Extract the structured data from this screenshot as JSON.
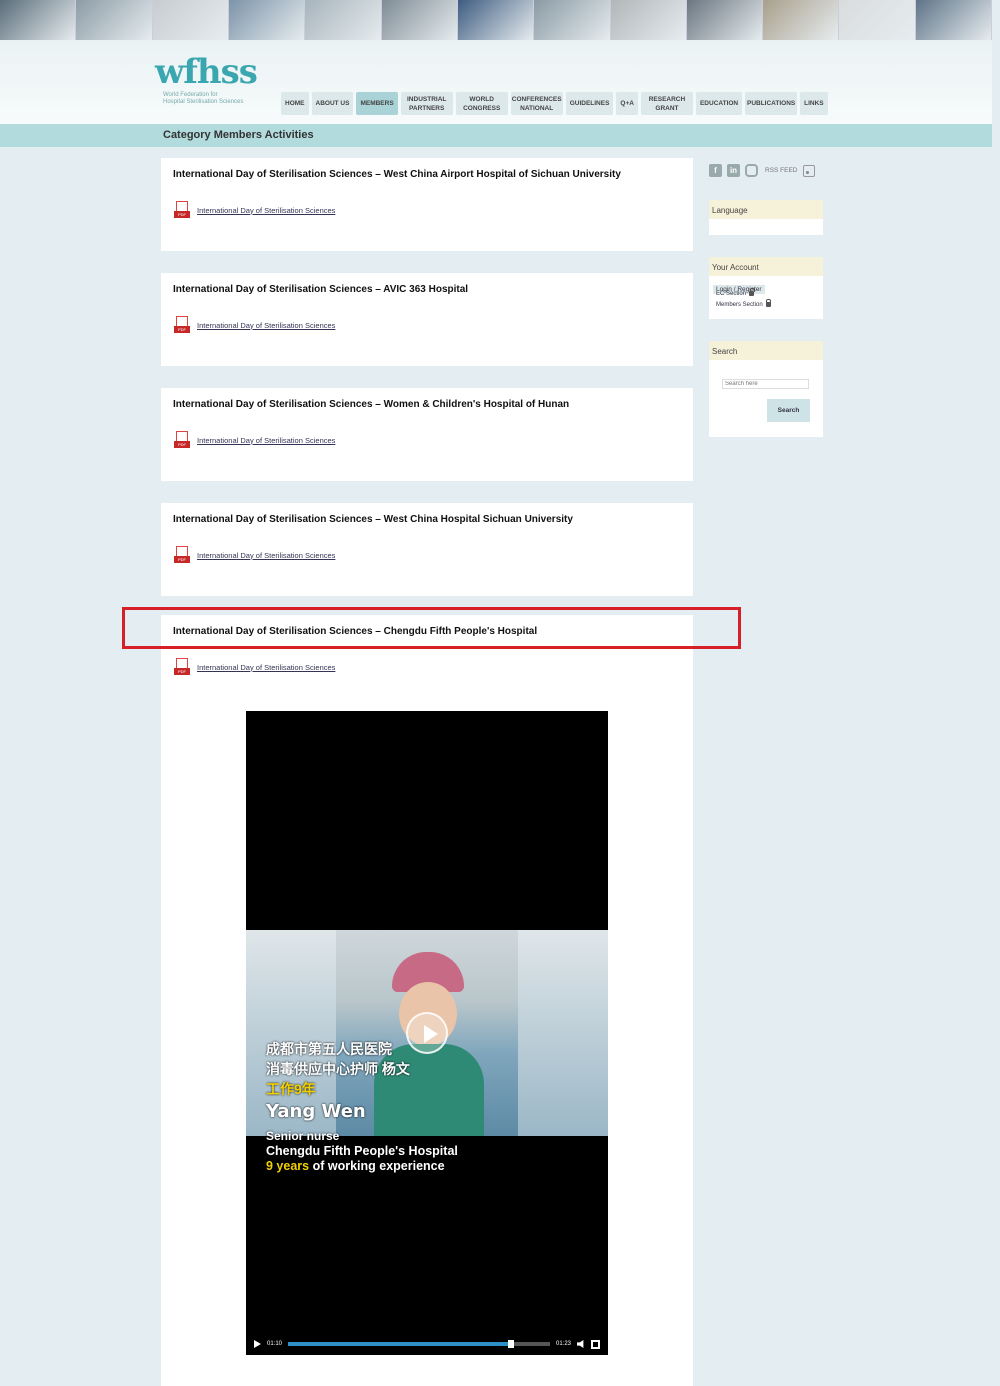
{
  "banner": {
    "tiles": [
      "#5a6d7a",
      "#8c9ca6",
      "#c7ccd0",
      "#7c93a8",
      "#a7b4bc",
      "#7f8c95",
      "#3e5c80",
      "#8a9aa4",
      "#b0b7b9",
      "#6b7680",
      "#a89f8b",
      "#d9dcdd",
      "#5f7488"
    ]
  },
  "header": {
    "logo_mark": "wfhss",
    "logo_sub_1": "World Federation for",
    "logo_sub_2": "Hospital Sterilisation Sciences",
    "nav": [
      {
        "label": "HOME"
      },
      {
        "label": "ABOUT US"
      },
      {
        "label": "MEMBERS",
        "active": true
      },
      {
        "label": "INDUSTRIAL PARTNERS"
      },
      {
        "label": "WORLD CONGRESS"
      },
      {
        "label": "CONFERENCES NATIONAL"
      },
      {
        "label": "GUIDELINES"
      },
      {
        "label": "Q+A"
      },
      {
        "label": "RESEARCH GRANT"
      },
      {
        "label": "EDUCATION"
      },
      {
        "label": "PUBLICATIONS"
      },
      {
        "label": "LINKS"
      }
    ]
  },
  "category": {
    "title": "Category Members Activities"
  },
  "articles": [
    {
      "title": "International Day of Sterilisation Sciences – West China Airport Hospital of Sichuan University",
      "link": "International Day of Sterilisation Sciences"
    },
    {
      "title": "International Day of Sterilisation Sciences – AVIC 363 Hospital",
      "link": "International Day of Sterilisation Sciences"
    },
    {
      "title": "International Day of Sterilisation Sciences – Women & Children's Hospital of Hunan",
      "link": "International Day of Sterilisation Sciences"
    },
    {
      "title": "International Day of Sterilisation Sciences – West China Hospital Sichuan University",
      "link": "International Day of Sterilisation Sciences"
    },
    {
      "title": "International Day of Sterilisation Sciences – Chengdu Fifth People's Hospital",
      "link": "International Day of Sterilisation Sciences"
    }
  ],
  "pdf_badge": "PDF",
  "video": {
    "caption_cn_1": "成都市第五人民医院",
    "caption_cn_2": "消毒供应中心护师 杨文",
    "caption_cn_3": "工作9年",
    "caption_name": "Yang Wen",
    "caption_en_1": "Senior nurse",
    "caption_en_2": "Chengdu Fifth People's Hospital",
    "caption_en_3_highlight": "9 years",
    "caption_en_3_rest": " of working experience",
    "time_current": "01:10",
    "time_total": "01:23",
    "progress": 0.85
  },
  "sidebar": {
    "social": {
      "facebook": "f",
      "linkedin": "in",
      "rss_label": "RSS FEED"
    },
    "language": {
      "title": "Language"
    },
    "account": {
      "title": "Your Account",
      "login": "Login / Register",
      "ec_section": "EC Section",
      "members_section": "Members Section"
    },
    "search": {
      "title": "Search",
      "placeholder": "Search here",
      "button": "Search"
    }
  },
  "colors": {
    "accent_teal": "#b2dbdd",
    "highlight_red": "#d61f26",
    "widget_title_bg": "#f6f2d9"
  }
}
